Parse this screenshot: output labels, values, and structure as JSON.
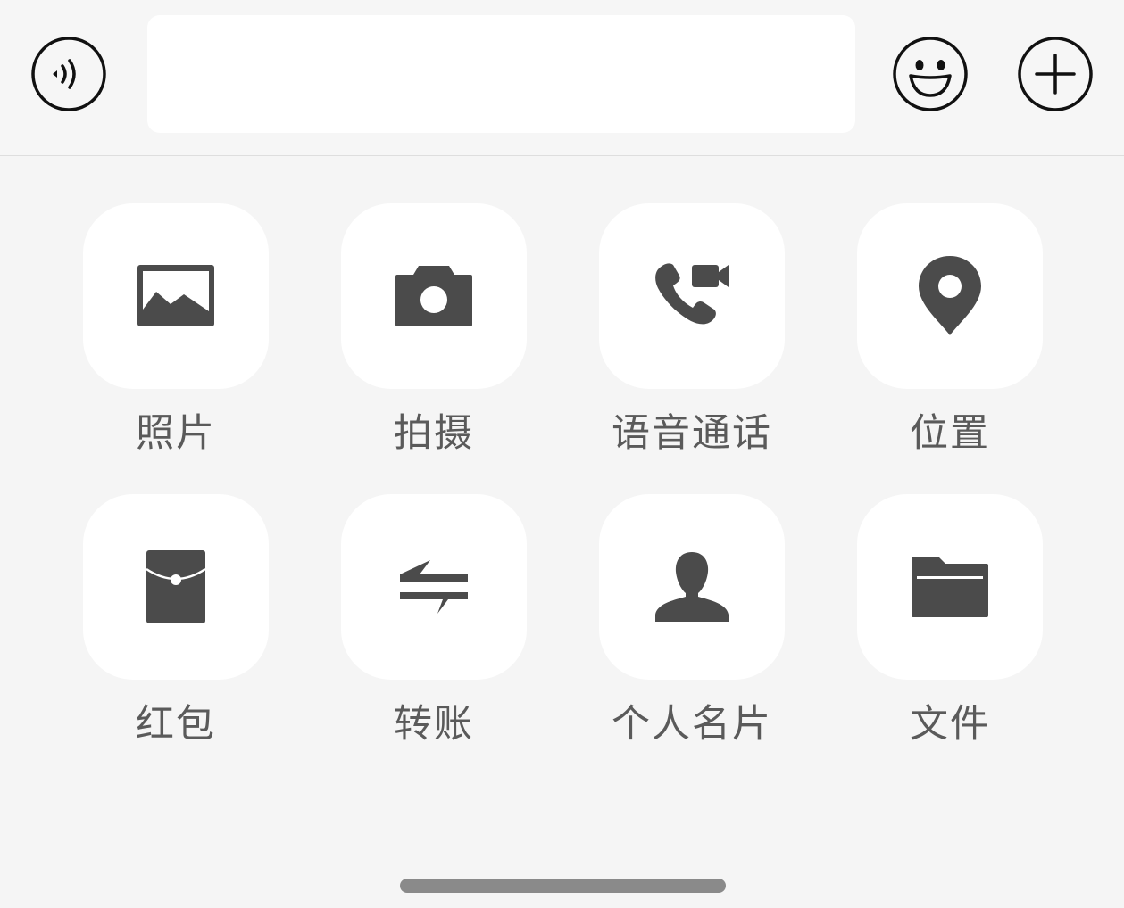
{
  "input_bar": {
    "voice_icon": "voice-waves-icon",
    "message_value": "",
    "message_placeholder": "",
    "emoji_icon": "smiley-face-icon",
    "more_icon": "plus-circle-icon"
  },
  "panel": {
    "items": [
      {
        "label": "照片",
        "icon": "photo-icon"
      },
      {
        "label": "拍摄",
        "icon": "camera-icon"
      },
      {
        "label": "语音通话",
        "icon": "call-video-icon"
      },
      {
        "label": "位置",
        "icon": "location-pin-icon"
      },
      {
        "label": "红包",
        "icon": "red-packet-icon"
      },
      {
        "label": "转账",
        "icon": "transfer-arrows-icon"
      },
      {
        "label": "个人名片",
        "icon": "contact-card-icon"
      },
      {
        "label": "文件",
        "icon": "folder-icon"
      }
    ]
  },
  "colors": {
    "background": "#f5f5f5",
    "tile": "#ffffff",
    "icon": "#4b4b4b",
    "label": "#5a5a5a",
    "home_indicator": "#8a8a8a"
  }
}
